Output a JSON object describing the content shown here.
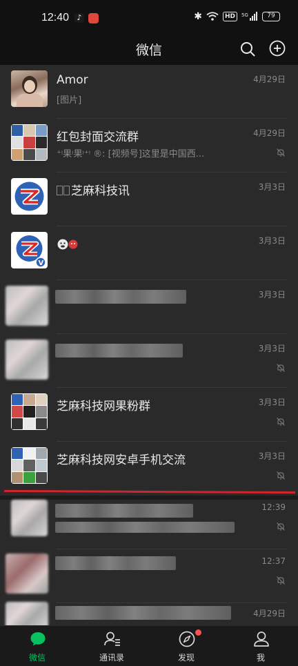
{
  "status_bar": {
    "time": "12:40",
    "battery": "79",
    "hd_label": "HD",
    "network": "5G"
  },
  "header": {
    "title": "微信",
    "search_icon": "search-icon",
    "add_icon": "plus-circle-icon"
  },
  "chats": [
    {
      "name": "Amor",
      "message": "[图片]",
      "time": "4月29日",
      "muted": false
    },
    {
      "name": "红包封面交流群",
      "message": "⁺ᵎ果ᵎ果ᵎ⁺ᵎ ®: [视频号]这里是中国西...",
      "time": "4月29日",
      "muted": true
    },
    {
      "name": "芝麻科技讯",
      "message": "",
      "time": "3月3日",
      "muted": false
    },
    {
      "name": "",
      "message": "",
      "time": "3月3日",
      "muted": false
    },
    {
      "name": "",
      "message": "",
      "time": "3月3日",
      "muted": false
    },
    {
      "name": "",
      "message": "",
      "time": "3月3日",
      "muted": true
    },
    {
      "name": "芝麻科技网果粉群",
      "message": "",
      "time": "3月3日",
      "muted": true
    },
    {
      "name": "芝麻科技网安卓手机交流",
      "message": "",
      "time": "3月3日",
      "muted": true
    },
    {
      "name": "",
      "message": "",
      "time": "12:39",
      "muted": true
    },
    {
      "name": "",
      "message": "",
      "time": "12:37",
      "muted": true
    },
    {
      "name": "",
      "message": "",
      "time": "4月29日",
      "muted": false
    }
  ],
  "tabbar": {
    "tabs": [
      {
        "label": "微信",
        "icon": "chat-bubble-icon",
        "active": true
      },
      {
        "label": "通讯录",
        "icon": "contacts-icon",
        "active": false
      },
      {
        "label": "发现",
        "icon": "compass-icon",
        "active": false,
        "badge_dot": true
      },
      {
        "label": "我",
        "icon": "person-icon",
        "active": false
      }
    ]
  },
  "colors": {
    "accent": "#07c160",
    "background": "#111111",
    "list_background": "#2a2a2a",
    "red_dot": "#fa5151",
    "annotation_line": "#d3242d"
  }
}
